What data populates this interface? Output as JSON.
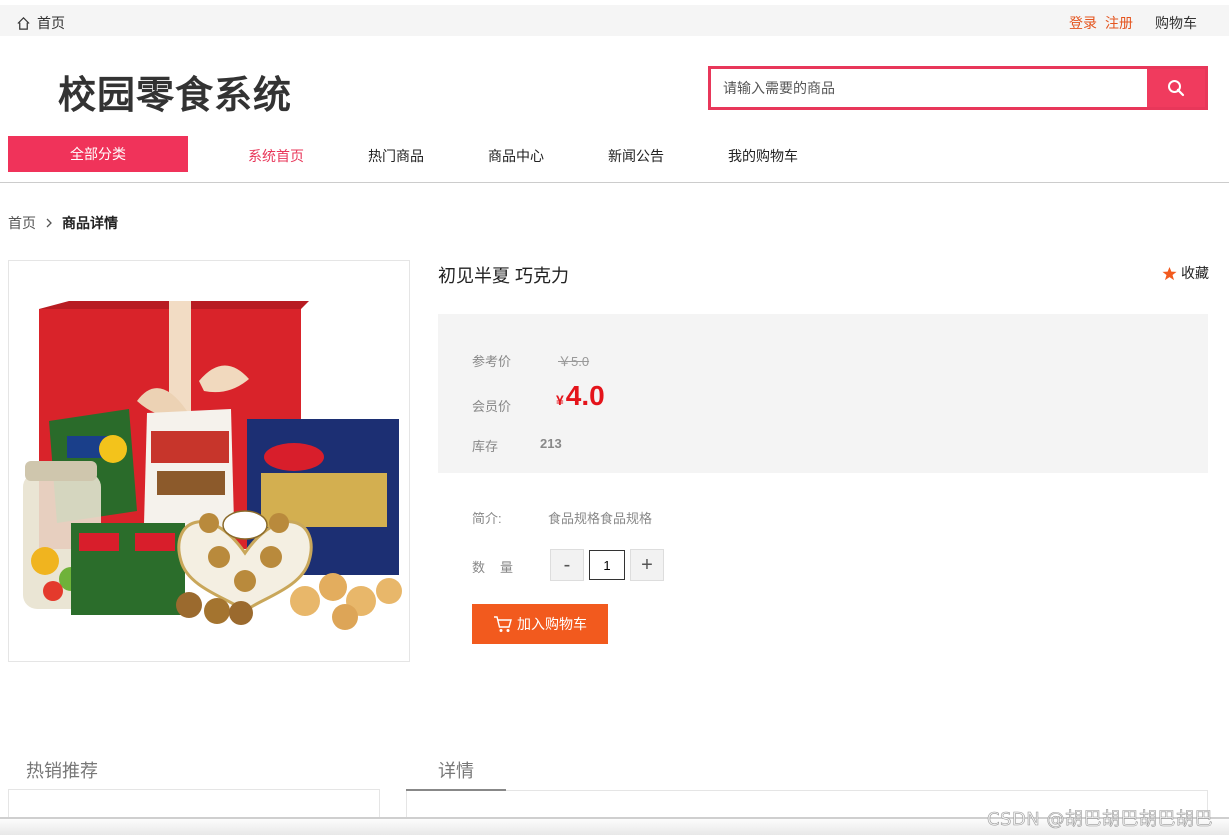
{
  "topbar": {
    "home_label": "首页",
    "login_label": "登录",
    "register_label": "注册",
    "cart_label": "购物车"
  },
  "header": {
    "site_title": "校园零食系统",
    "search_placeholder": "请输入需要的商品"
  },
  "nav": {
    "all_categories": "全部分类",
    "items": [
      {
        "label": "系统首页",
        "active": true
      },
      {
        "label": "热门商品",
        "active": false
      },
      {
        "label": "商品中心",
        "active": false
      },
      {
        "label": "新闻公告",
        "active": false
      },
      {
        "label": "我的购物车",
        "active": false
      }
    ]
  },
  "breadcrumb": {
    "home": "首页",
    "current": "商品详情"
  },
  "product": {
    "name": "初见半夏 巧克力",
    "favorite_label": "收藏",
    "ref_price_label": "参考价",
    "ref_price": "￥5.0",
    "member_price_label": "会员价",
    "currency_symbol": "¥",
    "member_price": "4.0",
    "stock_label": "库存",
    "stock": "213",
    "intro_label": "简介:",
    "intro": "食品规格食品规格",
    "quantity_label": "数量",
    "quantity": "1",
    "minus": "-",
    "plus": "+",
    "add_to_cart": "加入购物车"
  },
  "bottom": {
    "hot_title": "热销推荐",
    "detail_tab": "详情"
  },
  "watermark": "CSDN @胡巴胡巴胡巴胡巴",
  "colors": {
    "accent": "#f0335a",
    "price_red": "#e4141b",
    "cart_orange": "#f25a1e",
    "link_orange": "#e4551f"
  }
}
